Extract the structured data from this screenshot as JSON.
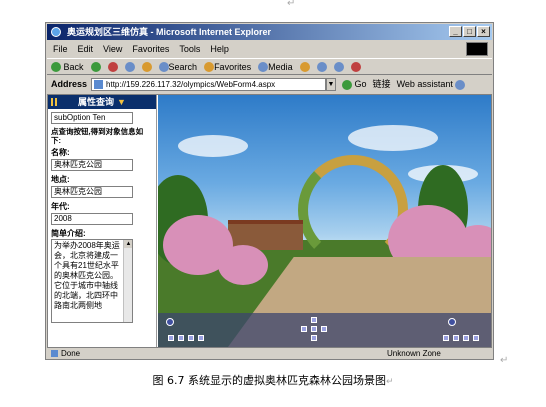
{
  "paragraph_mark": "↵",
  "window": {
    "title": "奥运规划区三维仿真 - Microsoft Internet Explorer",
    "controls": [
      "_",
      "□",
      "×"
    ]
  },
  "menu": [
    "File",
    "Edit",
    "View",
    "Favorites",
    "Tools",
    "Help"
  ],
  "toolbar": {
    "back": "Back",
    "search": "Search",
    "favorites": "Favorites",
    "media": "Media"
  },
  "address": {
    "label": "Address",
    "url": "http://159.226.117.32/olympics/WebForm4.aspx",
    "go": "Go",
    "links": "链接",
    "assistant": "Web assistant"
  },
  "sidebar": {
    "header": "属性查询",
    "option": "subOption Ten",
    "instruction": "点查询按钮,得到对象信息如下:",
    "name_label": "名称:",
    "name_value": "奥林匹克公园",
    "location_label": "地点:",
    "location_value": "奥林匹克公园",
    "year_label": "年代:",
    "year_value": "2008",
    "intro_label": "简单介绍:",
    "intro_text": "为举办2008年奥运会，北京将建成一个具有21世纪水平的奥林匹克公园。它位于城市中轴线的北端，北四环中路南北两侧地"
  },
  "status": {
    "left": "Done",
    "zone": "Unknown Zone"
  },
  "caption": "图 6.7  系统显示的虚拟奥林匹克森林公园场景图"
}
